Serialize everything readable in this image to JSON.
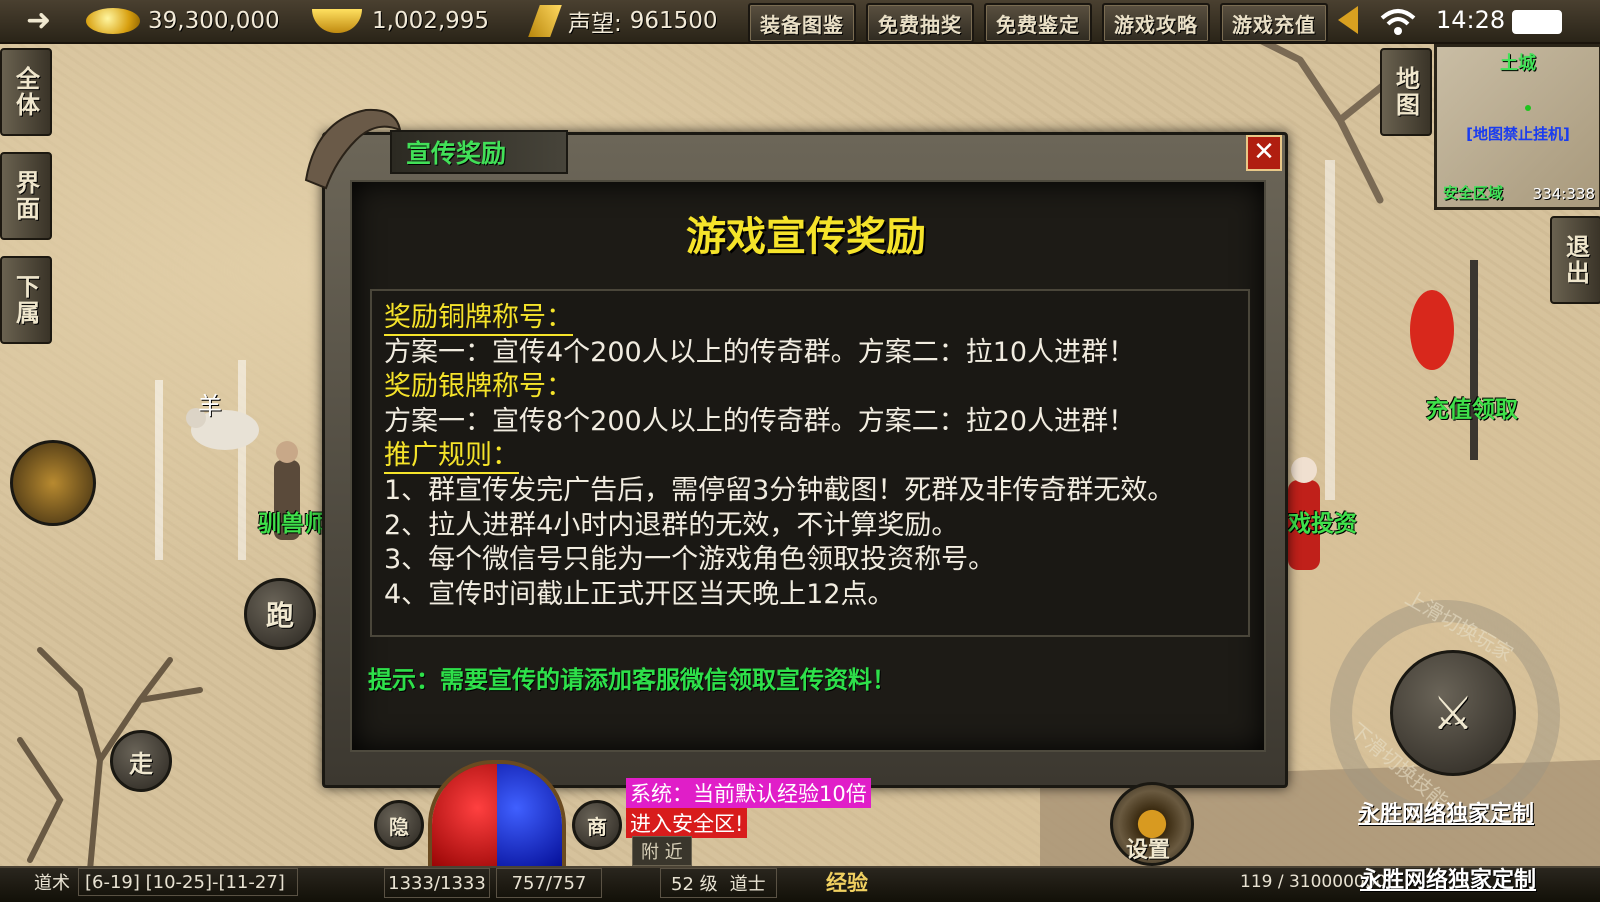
{
  "topbar": {
    "gold": "39,300,000",
    "ingot": "1,002,995",
    "reputation_label": "声望:",
    "reputation_value": "961500",
    "buttons": [
      "装备图鉴",
      "免费抽奖",
      "免费鉴定",
      "游戏攻略",
      "游戏充值"
    ],
    "time": "14:28"
  },
  "left_tabs": [
    "全体",
    "界面",
    "下属"
  ],
  "right_tabs": {
    "map": "地图",
    "exit": "退出"
  },
  "minimap": {
    "area_name": "土城",
    "notice": "[地图禁止挂机]",
    "safe_zone": "安全区域",
    "coords": "334:338"
  },
  "npcs": {
    "sheep": "羊",
    "tamer": "驯兽师",
    "invest": "戏投资",
    "recharge": "充值领取"
  },
  "controls": {
    "run": "跑",
    "walk": "走",
    "hide": "隐",
    "shop": "商",
    "settings": "设置",
    "swipe_up": "上滑切换玩家",
    "swipe_down": "下滑切换技能"
  },
  "dialog": {
    "tab_title": "宣传奖励",
    "close": "✕",
    "heading": "游戏宣传奖励",
    "bronze_title": "奖励铜牌称号：",
    "bronze_desc": "方案一：宣传4个200人以上的传奇群。方案二：拉10人进群！",
    "silver_title": "奖励银牌称号：",
    "silver_desc": "方案一：宣传8个200人以上的传奇群。方案二：拉20人进群！",
    "rules_title": "推广规则：",
    "rules": [
      "1、群宣传发完广告后，需停留3分钟截图！死群及非传奇群无效。",
      "2、拉人进群4小时内退群的无效，不计算奖励。",
      "3、每个微信号只能为一个游戏角色领取投资称号。",
      "4、宣传时间截止正式开区当天晚上12点。"
    ],
    "tip": "提示：需要宣传的请添加客服微信领取宣传资料！"
  },
  "chat": {
    "system_msg": "系统：当前默认经验10倍",
    "safe_msg": "进入安全区!",
    "channel": "附 近"
  },
  "watermark": "永胜网络独家定制",
  "bottom": {
    "skill_name": "道术",
    "skill_values": "[6-19] [10-25]-[11-27]",
    "hp": "1333/1333",
    "mp": "757/757",
    "level": "52 级",
    "class": "道士",
    "exp_label": "经验",
    "exp_value": "119 / 310000000"
  },
  "colors": {
    "npc_green": "#3fe04a",
    "title_yellow": "#f5e32a",
    "close_red": "#b01e10",
    "system_magenta": "#e01ec8"
  }
}
